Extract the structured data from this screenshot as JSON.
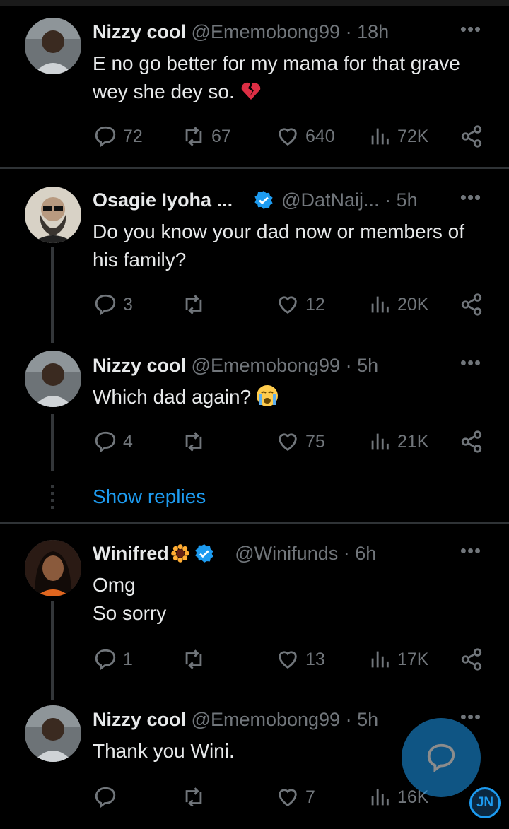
{
  "theme": {
    "background": "#000000",
    "text": "#e7e9ea",
    "muted": "#71767b",
    "accent": "#1d9bf0"
  },
  "tweets": [
    {
      "name": "Nizzy cool",
      "handle": "@Ememobong99",
      "time": "· 18h",
      "text": "E no go better for my mama for that grave wey she dey so.",
      "emoji": "broken-heart",
      "replies": "72",
      "retweets": "67",
      "likes": "640",
      "views": "72K"
    },
    {
      "name": "Osagie Iyoha ...",
      "verified": true,
      "handle": "@DatNaij...",
      "time": "· 5h",
      "text": "Do you know your dad now or members of his family?",
      "replies": "3",
      "retweets": "",
      "likes": "12",
      "views": "20K"
    },
    {
      "name": "Nizzy cool",
      "handle": "@Ememobong99",
      "time": "· 5h",
      "text": "Which dad again?",
      "emoji": "loudly-crying-face",
      "replies": "4",
      "retweets": "",
      "likes": "75",
      "views": "21K"
    },
    {
      "name": "Winifred",
      "name_emoji": "sunflower",
      "verified": true,
      "handle": "@Winifunds",
      "time": "· 6h",
      "text": "Omg\nSo sorry",
      "replies": "1",
      "retweets": "",
      "likes": "13",
      "views": "17K"
    },
    {
      "name": "Nizzy cool",
      "handle": "@Ememobong99",
      "time": "· 5h",
      "text": "Thank you Wini.",
      "replies": "",
      "retweets": "",
      "likes": "7",
      "views": "16K"
    }
  ],
  "show_replies_label": "Show replies",
  "more_label": "•••",
  "watermark": "JN",
  "icons": [
    "reply-icon",
    "retweet-icon",
    "like-icon",
    "views-icon",
    "share-icon",
    "more-icon",
    "verified-badge-icon",
    "compose-reply-icon"
  ]
}
